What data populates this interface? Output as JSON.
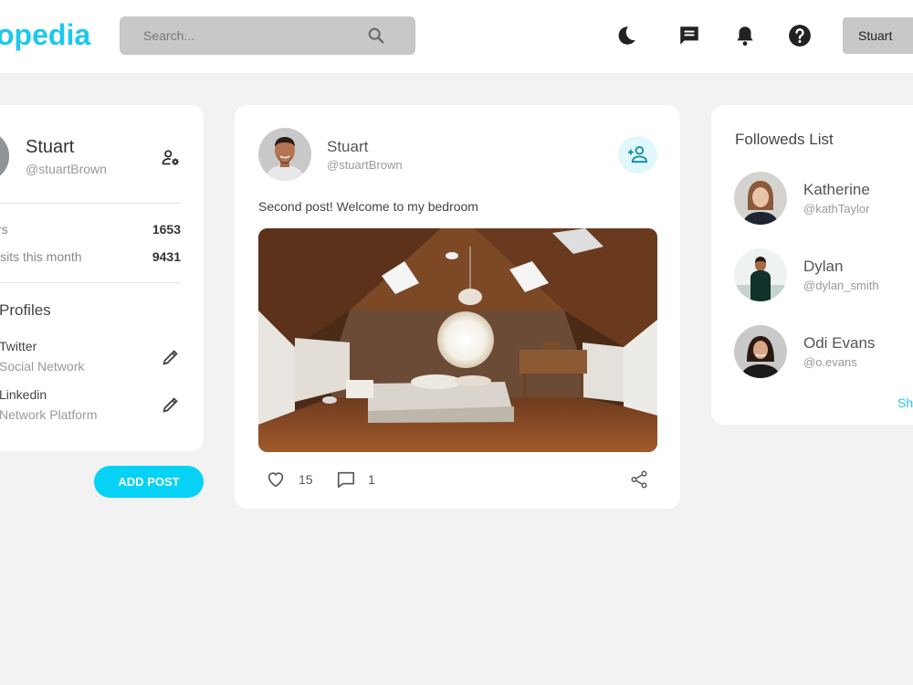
{
  "header": {
    "logo": "opedia",
    "search_placeholder": "Search...",
    "user_button": "Stuart"
  },
  "icons": {
    "theme": "moon-icon",
    "messages": "chat-icon",
    "notifications": "bell-icon",
    "help": "help-icon"
  },
  "profile": {
    "name": "Stuart",
    "handle": "@stuartBrown",
    "stats": [
      {
        "label": "rs",
        "value": "1653"
      },
      {
        "label": "isits this month",
        "value": "9431"
      }
    ],
    "profiles_title": "Profiles",
    "profiles": [
      {
        "name": "Twitter",
        "type": "Social Network"
      },
      {
        "name": "Linkedin",
        "type": "Network Platform"
      }
    ],
    "add_post": "ADD POST"
  },
  "post": {
    "author": "Stuart",
    "handle": "@stuartBrown",
    "text": "Second post! Welcome to my bedroom",
    "likes": "15",
    "comments": "1"
  },
  "followeds": {
    "title": "Followeds List",
    "items": [
      {
        "name": "Katherine",
        "handle": "@kathTaylor"
      },
      {
        "name": "Dylan",
        "handle": "@dylan_smith"
      },
      {
        "name": "Odi Evans",
        "handle": "@o.evans"
      }
    ],
    "show_more": "Sh"
  },
  "colors": {
    "accent": "#06d2f6",
    "logo": "#1dc8ee",
    "background": "#f2f2f2"
  }
}
